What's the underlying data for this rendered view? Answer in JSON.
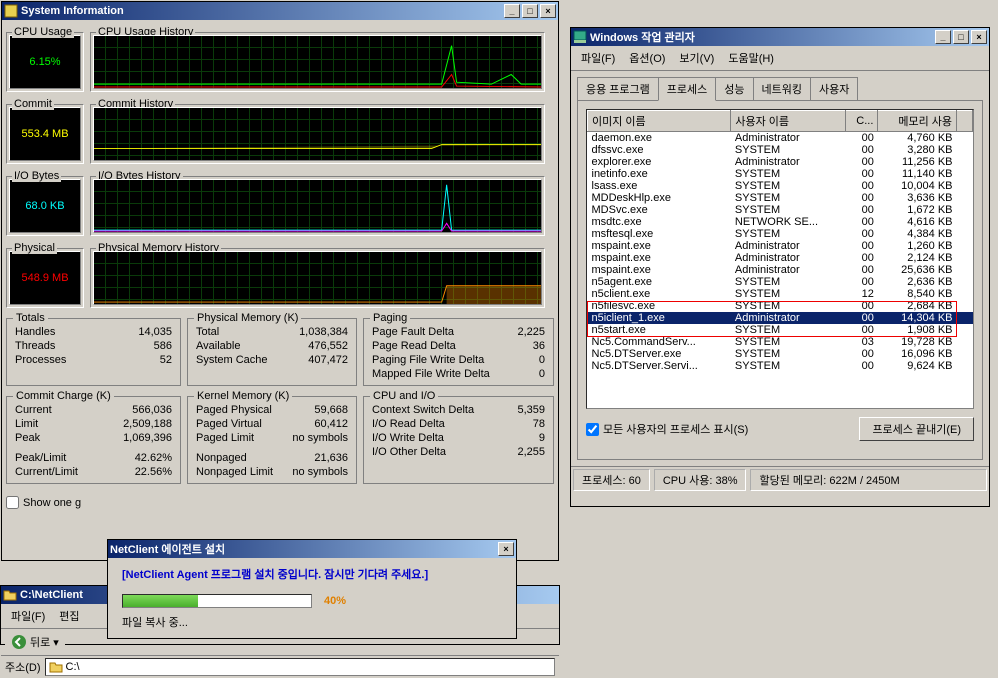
{
  "sysinfo": {
    "title": "System Information",
    "cpu_usage_label": "CPU Usage",
    "cpu_usage_value": "6.15%",
    "cpu_history_label": "CPU Usage History",
    "commit_label": "Commit",
    "commit_value": "553.4 MB",
    "commit_history_label": "Commit History",
    "io_label": "I/O Bytes",
    "io_value": "68.0  KB",
    "io_history_label": "I/O Bytes History",
    "phys_label": "Physical",
    "phys_value": "548.9 MB",
    "phys_history_label": "Physical Memory History",
    "totals": {
      "label": "Totals",
      "handles_l": "Handles",
      "handles_v": "14,035",
      "threads_l": "Threads",
      "threads_v": "586",
      "processes_l": "Processes",
      "processes_v": "52"
    },
    "physmem": {
      "label": "Physical Memory (K)",
      "total_l": "Total",
      "total_v": "1,038,384",
      "avail_l": "Available",
      "avail_v": "476,552",
      "cache_l": "System Cache",
      "cache_v": "407,472"
    },
    "paging": {
      "label": "Paging",
      "pf_l": "Page Fault Delta",
      "pf_v": "2,225",
      "pr_l": "Page Read Delta",
      "pr_v": "36",
      "pw_l": "Paging File Write Delta",
      "pw_v": "0",
      "mw_l": "Mapped File Write Delta",
      "mw_v": "0"
    },
    "commitcharge": {
      "label": "Commit Charge (K)",
      "cur_l": "Current",
      "cur_v": "566,036",
      "lim_l": "Limit",
      "lim_v": "2,509,188",
      "peak_l": "Peak",
      "peak_v": "1,069,396",
      "pl_l": "Peak/Limit",
      "pl_v": "42.62%",
      "cl_l": "Current/Limit",
      "cl_v": "22.56%"
    },
    "kernel": {
      "label": "Kernel Memory (K)",
      "pp_l": "Paged Physical",
      "pp_v": "59,668",
      "pv_l": "Paged Virtual",
      "pv_v": "60,412",
      "plim_l": "Paged Limit",
      "plim_v": "no symbols",
      "np_l": "Nonpaged",
      "np_v": "21,636",
      "nplim_l": "Nonpaged Limit",
      "nplim_v": "no symbols"
    },
    "cpuio": {
      "label": "CPU and I/O",
      "cs_l": "Context Switch Delta",
      "cs_v": "5,359",
      "ir_l": "I/O Read Delta",
      "ir_v": "78",
      "iw_l": "I/O Write Delta",
      "iw_v": "9",
      "io_l": "I/O Other Delta",
      "io_v": "2,255"
    },
    "show_one": "Show one g"
  },
  "taskmgr": {
    "title": "Windows 작업 관리자",
    "menu": {
      "file": "파일(F)",
      "options": "옵션(O)",
      "view": "보기(V)",
      "help": "도움말(H)"
    },
    "tabs": {
      "apps": "응용 프로그램",
      "procs": "프로세스",
      "perf": "성능",
      "net": "네트워킹",
      "users": "사용자"
    },
    "cols": {
      "image": "이미지 이름",
      "user": "사용자 이름",
      "cpu": "C...",
      "mem": "메모리 사용"
    },
    "rows": [
      {
        "img": "daemon.exe",
        "user": "Administrator",
        "cpu": "00",
        "mem": "4,760 KB"
      },
      {
        "img": "dfssvc.exe",
        "user": "SYSTEM",
        "cpu": "00",
        "mem": "3,280 KB"
      },
      {
        "img": "explorer.exe",
        "user": "Administrator",
        "cpu": "00",
        "mem": "11,256 KB"
      },
      {
        "img": "inetinfo.exe",
        "user": "SYSTEM",
        "cpu": "00",
        "mem": "11,140 KB"
      },
      {
        "img": "lsass.exe",
        "user": "SYSTEM",
        "cpu": "00",
        "mem": "10,004 KB"
      },
      {
        "img": "MDDeskHlp.exe",
        "user": "SYSTEM",
        "cpu": "00",
        "mem": "3,636 KB"
      },
      {
        "img": "MDSvc.exe",
        "user": "SYSTEM",
        "cpu": "00",
        "mem": "1,672 KB"
      },
      {
        "img": "msdtc.exe",
        "user": "NETWORK SE...",
        "cpu": "00",
        "mem": "4,616 KB"
      },
      {
        "img": "msftesql.exe",
        "user": "SYSTEM",
        "cpu": "00",
        "mem": "4,384 KB"
      },
      {
        "img": "mspaint.exe",
        "user": "Administrator",
        "cpu": "00",
        "mem": "1,260 KB"
      },
      {
        "img": "mspaint.exe",
        "user": "Administrator",
        "cpu": "00",
        "mem": "2,124 KB"
      },
      {
        "img": "mspaint.exe",
        "user": "Administrator",
        "cpu": "00",
        "mem": "25,636 KB"
      },
      {
        "img": "n5agent.exe",
        "user": "SYSTEM",
        "cpu": "00",
        "mem": "2,636 KB"
      },
      {
        "img": "n5client.exe",
        "user": "SYSTEM",
        "cpu": "12",
        "mem": "8,540 KB"
      },
      {
        "img": "n5filesvc.exe",
        "user": "SYSTEM",
        "cpu": "00",
        "mem": "2,684 KB"
      },
      {
        "img": "n5iclient_1.exe",
        "user": "Administrator",
        "cpu": "00",
        "mem": "14,304 KB",
        "sel": true
      },
      {
        "img": "n5start.exe",
        "user": "SYSTEM",
        "cpu": "00",
        "mem": "1,908 KB"
      },
      {
        "img": "Nc5.CommandServ...",
        "user": "SYSTEM",
        "cpu": "03",
        "mem": "19,728 KB"
      },
      {
        "img": "Nc5.DTServer.exe",
        "user": "SYSTEM",
        "cpu": "00",
        "mem": "16,096 KB"
      },
      {
        "img": "Nc5.DTServer.Servi...",
        "user": "SYSTEM",
        "cpu": "00",
        "mem": "9,624 KB"
      }
    ],
    "show_all": "모든 사용자의 프로세스 표시(S)",
    "end_btn": "프로세스 끝내기(E)",
    "status": {
      "procs": "프로세스: 60",
      "cpu": "CPU 사용: 38%",
      "mem": "할당된 메모리: 622M / 2450M"
    }
  },
  "installer": {
    "title": "NetClient 에이전트 설치",
    "msg": "[NetClient Agent 프로그램 설치 중입니다. 잠시만 기다려 주세요.]",
    "pct": "40%",
    "pct_num": 40,
    "status": "파일 복사 중..."
  },
  "folder": {
    "title": "C:\\NetClient",
    "menu_file": "파일(F)",
    "menu_edit": "편집",
    "back": "뒤로",
    "addr_label": "주소(D)",
    "addr_value": "C:\\"
  }
}
